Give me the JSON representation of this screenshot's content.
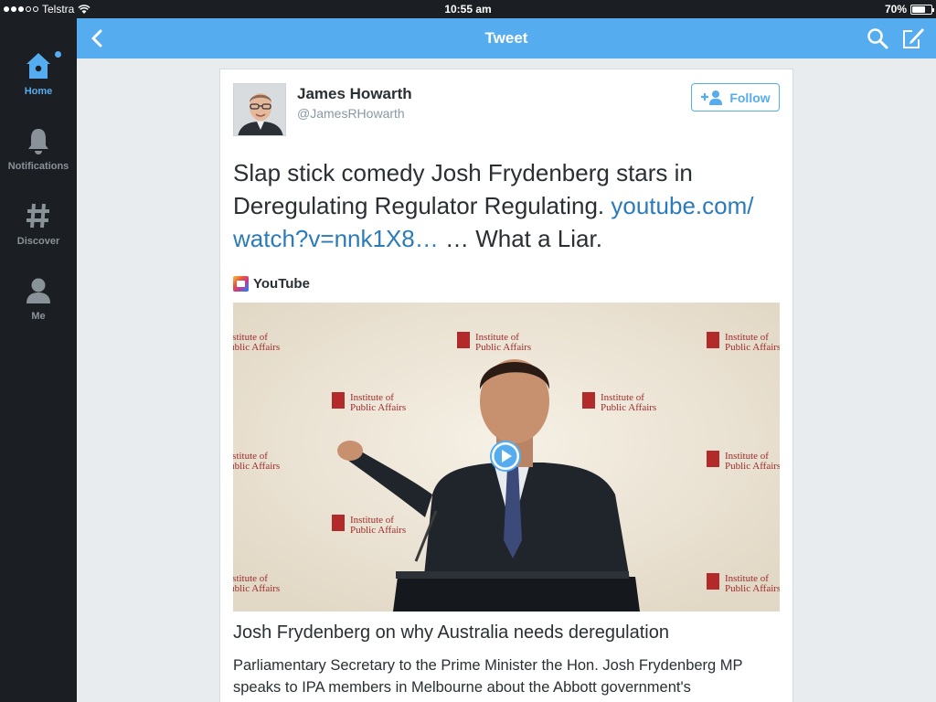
{
  "status_bar": {
    "carrier": "Telstra",
    "time": "10:55 am",
    "battery": "70%",
    "battery_level": 0.7
  },
  "sidebar": {
    "items": [
      {
        "label": "Home",
        "icon": "home-icon",
        "active": true
      },
      {
        "label": "Notifications",
        "icon": "bell-icon",
        "active": false
      },
      {
        "label": "Discover",
        "icon": "hashtag-icon",
        "active": false
      },
      {
        "label": "Me",
        "icon": "person-icon",
        "active": false
      }
    ]
  },
  "header": {
    "title": "Tweet"
  },
  "tweet": {
    "author_name": "James Howarth",
    "author_handle": "@JamesRHowarth",
    "follow_label": "Follow",
    "text_before": "Slap stick comedy Josh Frydenberg stars in Deregulating Regulator Regulating. ",
    "link_text": "youtube.com/ watch?v=nnk1X8…",
    "text_after": " … What a Liar.",
    "card": {
      "source": "YouTube",
      "title": "Josh Frydenberg on why Australia needs deregulation",
      "description": "Parliamentary Secretary to the Prime Minister the Hon. Josh Frydenberg MP speaks to IPA members in Melbourne about the Abbott government's",
      "backdrop_text_1": "Institute of",
      "backdrop_text_2": "Public Affairs"
    }
  },
  "colors": {
    "accent": "#55acee",
    "dark": "#1b1e22",
    "link": "#2b7bb9"
  }
}
